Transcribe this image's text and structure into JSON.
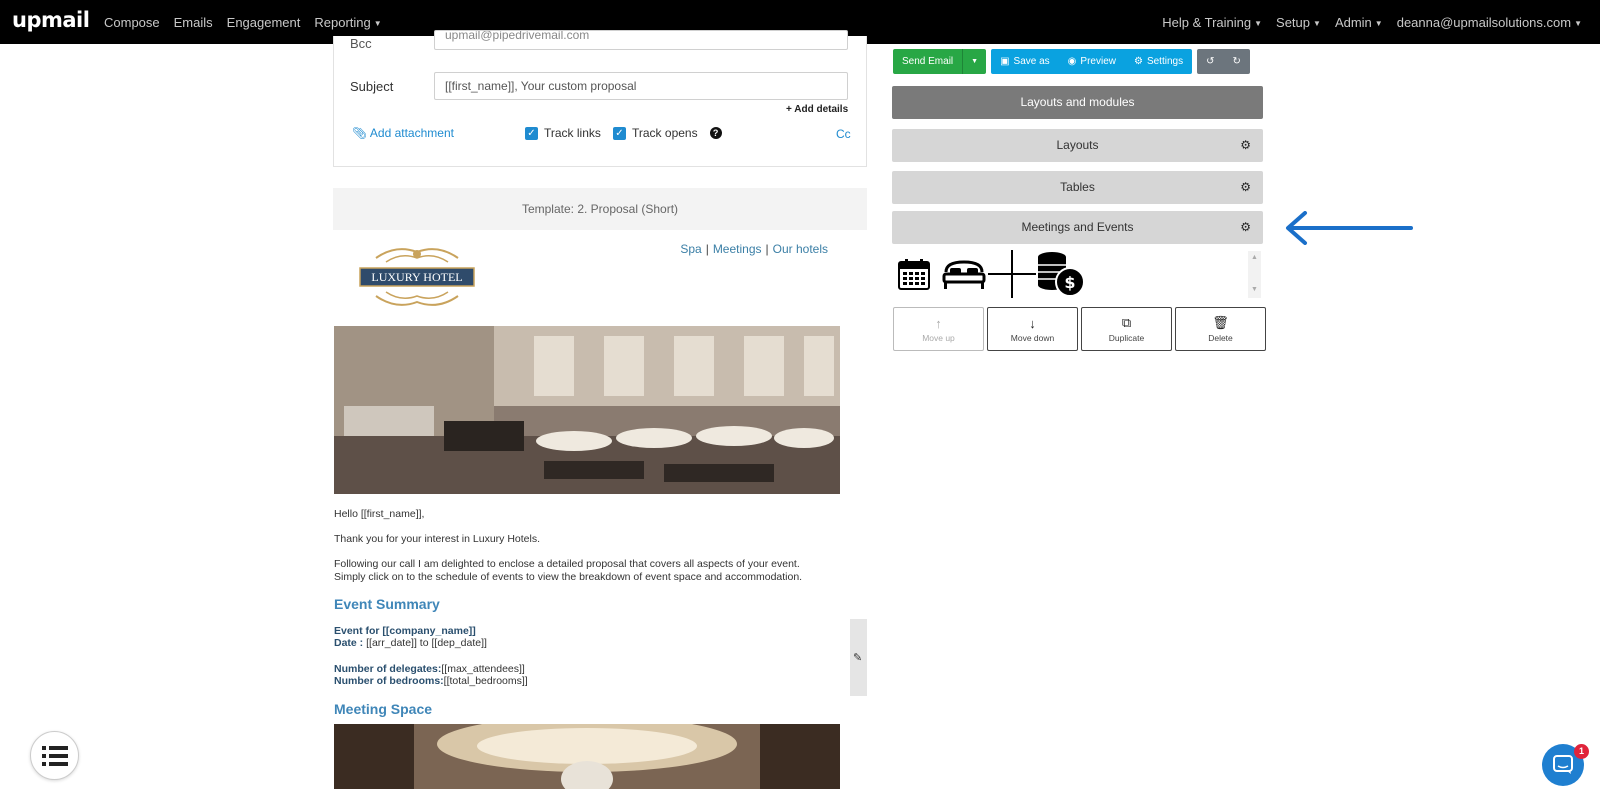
{
  "nav": {
    "logo": "upmail",
    "left": [
      "Compose",
      "Emails",
      "Engagement",
      "Reporting"
    ],
    "right": [
      "Help & Training",
      "Setup",
      "Admin",
      "deanna@upmailsolutions.com"
    ]
  },
  "form": {
    "bcc_label": "Bcc",
    "bcc_value": "upmail@pipedrivemail.com",
    "subject_label": "Subject",
    "subject_value": "[[first_name]], Your custom proposal",
    "add_details": "+ Add details",
    "add_attachment": "Add attachment",
    "track_links": "Track links",
    "track_opens": "Track opens",
    "cc": "Cc"
  },
  "template": {
    "label": "Template: 2. Proposal (Short)"
  },
  "email": {
    "logo_text": "LUXURY HOTEL",
    "links": [
      "Spa",
      "Meetings",
      "Our hotels"
    ],
    "greeting": "Hello [[first_name]],",
    "thanks": "Thank you for your interest in Luxury Hotels.",
    "para1": "Following our call I am delighted to enclose a detailed proposal that covers all aspects of your event.",
    "para2": "Simply click on to the schedule of events to view the breakdown of event space and accommodation.",
    "event_summary_heading": "Event Summary",
    "event_for_label": "Event for [[company_name]]",
    "date_label": "Date :",
    "date_value": "[[arr_date]] to [[dep_date]]",
    "delegates_label": "Number of delegates:",
    "delegates_value": "[[max_attendees]]",
    "bedrooms_label": "Number of bedrooms:",
    "bedrooms_value": "[[total_bedrooms]]",
    "meeting_space_heading": "Meeting Space"
  },
  "toolbar": {
    "send_email": "Send Email",
    "save_as": "Save as",
    "preview": "Preview",
    "settings": "Settings"
  },
  "builder": {
    "header": "Layouts and modules",
    "sections": [
      "Layouts",
      "Tables",
      "Meetings and Events"
    ],
    "icons": [
      "calendar-icon",
      "bed-icon",
      "plus-icon",
      "coins-dollar-icon"
    ],
    "controls": [
      "Move up",
      "Move down",
      "Duplicate",
      "Delete"
    ]
  },
  "chat": {
    "badge_count": "1"
  },
  "colors": {
    "nav_bg": "#000000",
    "send_green": "#28a745",
    "action_blue": "#0aa2e0",
    "heading_blue": "#3f86b8",
    "arrow_blue": "#1a6fc9"
  }
}
